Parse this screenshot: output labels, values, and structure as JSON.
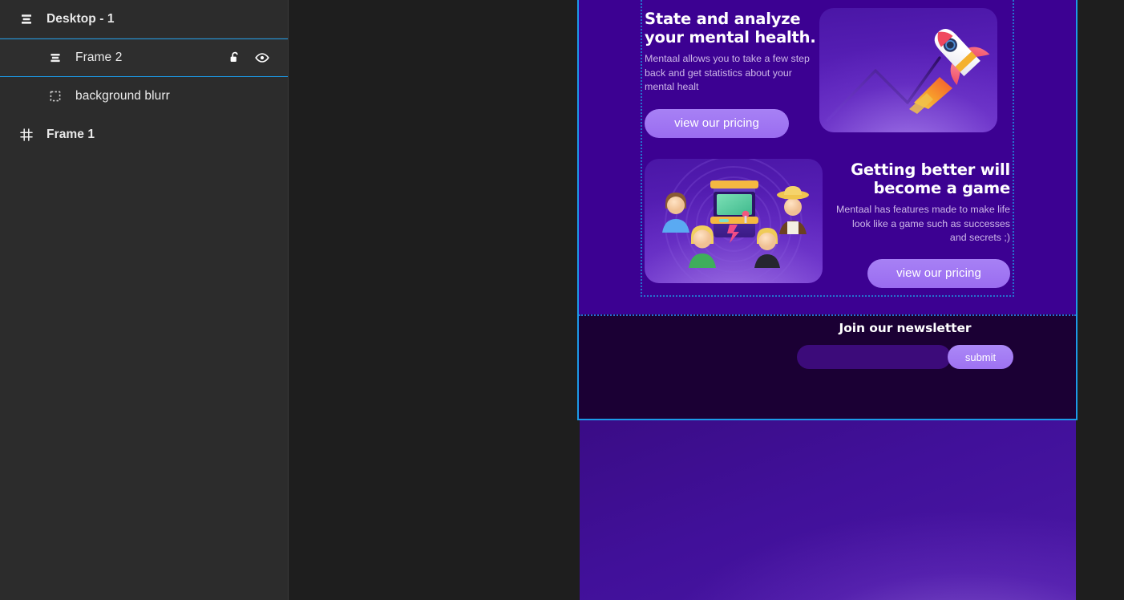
{
  "sidebar": {
    "page": {
      "label": "Desktop - 1",
      "icon": "layers-stack-icon"
    },
    "layers": [
      {
        "label": "Frame 2",
        "icon": "auto-layout-vertical-icon",
        "selected": true,
        "actions": [
          {
            "name": "unlock-icon",
            "label": "unlock"
          },
          {
            "name": "visible-eye-icon",
            "label": "toggle visibility"
          }
        ]
      },
      {
        "label": "background blurr",
        "icon": "group-dashed-icon",
        "selected": false
      },
      {
        "label": "Frame 1",
        "icon": "frame-hash-icon",
        "selected": false
      }
    ]
  },
  "canvas": {
    "selected_frame": "Frame 2",
    "selection_color": "#1c9ae8",
    "guide_color": "#2472cf",
    "frame_background": "#3c0192",
    "newsletter_background": "#1b0034",
    "accent_button": "#9e72f1"
  },
  "features": [
    {
      "title": "State and analyze your mental health.",
      "description": "Mentaal allows you to take a few step back and get statistics about your mental healt",
      "button_label": "view our pricing",
      "art": "rocket-growth-chart-illustration",
      "layout": "text-left"
    },
    {
      "title": "Getting better will become a game",
      "description": "Mentaal has features made to make life look like a game such as successes and secrets ;)",
      "button_label": "view our pricing",
      "art": "arcade-machine-people-illustration",
      "layout": "text-right"
    }
  ],
  "newsletter": {
    "title": "Join our newsletter",
    "input_value": "",
    "input_placeholder": "",
    "submit_label": "submit"
  }
}
